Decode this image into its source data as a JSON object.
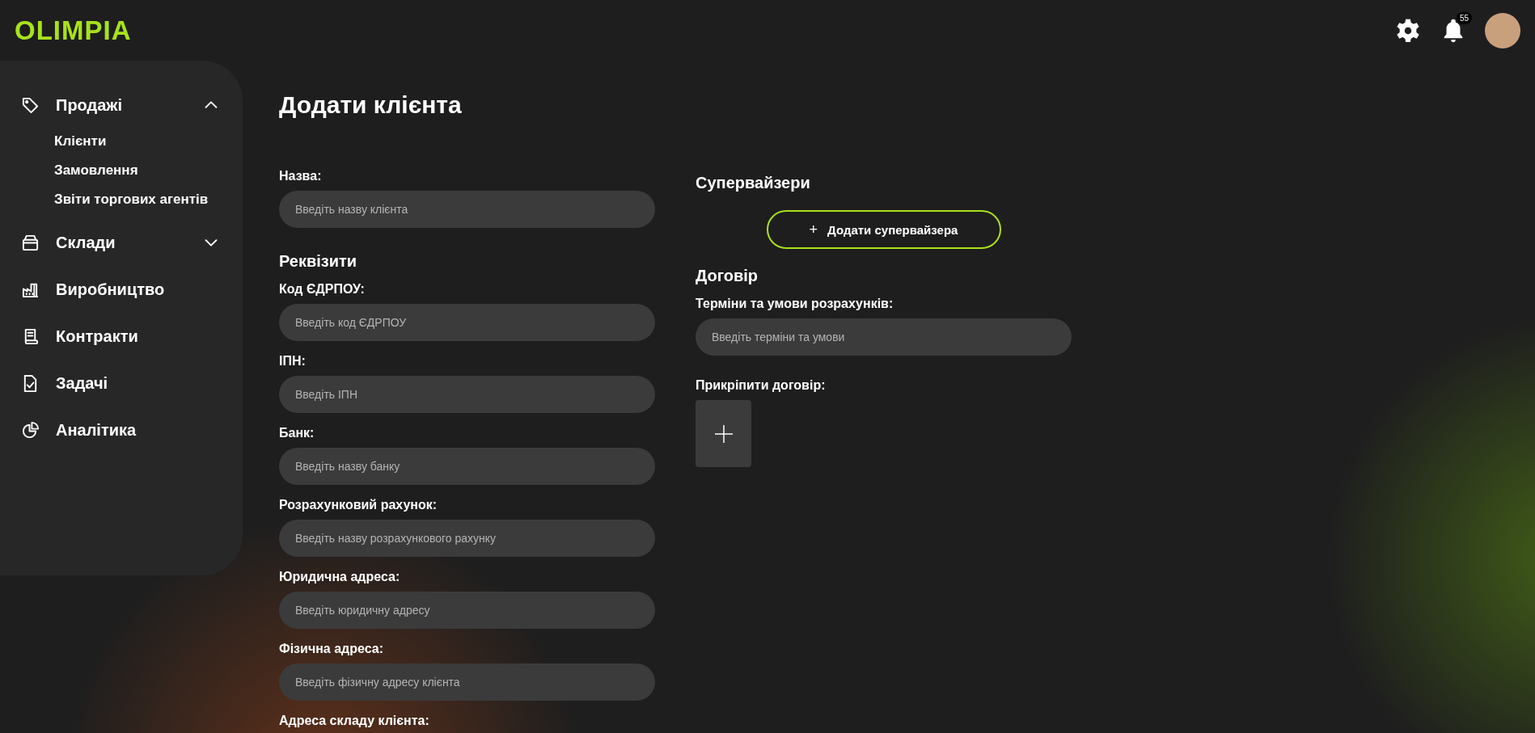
{
  "header": {
    "logo": "OLIMPIA",
    "notifications_badge": "55"
  },
  "sidebar": {
    "items": [
      {
        "kind": "tag",
        "label": "Продажі",
        "expanded": true,
        "children": [
          {
            "label": "Клієнти"
          },
          {
            "label": "Замовлення"
          },
          {
            "label": "Звіти торгових агентів"
          }
        ]
      },
      {
        "kind": "box",
        "label": "Склади",
        "expanded": false
      },
      {
        "kind": "factory",
        "label": "Виробництво"
      },
      {
        "kind": "receipt",
        "label": "Контракти"
      },
      {
        "kind": "task",
        "label": "Задачі"
      },
      {
        "kind": "chart",
        "label": "Аналітика"
      }
    ]
  },
  "page_title": "Додати клієнта",
  "form": {
    "name_field": {
      "label": "Назва:",
      "placeholder": "Введіть назву клієнта"
    },
    "requisites": {
      "heading": "Реквізити",
      "fields": [
        {
          "label": "Код ЄДРПОУ:",
          "placeholder": "Введіть код ЄДРПОУ"
        },
        {
          "label": "ІПН:",
          "placeholder": "Введіть ІПН"
        },
        {
          "label": "Банк:",
          "placeholder": "Введіть назву банку"
        },
        {
          "label": "Розрахунковий рахунок:",
          "placeholder": "Введіть назву розрахункового рахунку"
        },
        {
          "label": "Юридична адреса:",
          "placeholder": "Введіть юридичну адресу"
        },
        {
          "label": "Фізична адреса:",
          "placeholder": "Введіть фізичну адресу клієнта"
        },
        {
          "label": "Адреса складу клієнта:"
        }
      ]
    },
    "supervisors": {
      "heading": "Супервайзери",
      "button": "Додати супервайзера",
      "button_icon": "+"
    },
    "contract": {
      "heading": "Договір",
      "terms": {
        "label": "Терміни та умови розрахунків:",
        "placeholder": "Введіть терміни та умови"
      },
      "attach": {
        "label": "Прикріпити договір:"
      }
    }
  }
}
